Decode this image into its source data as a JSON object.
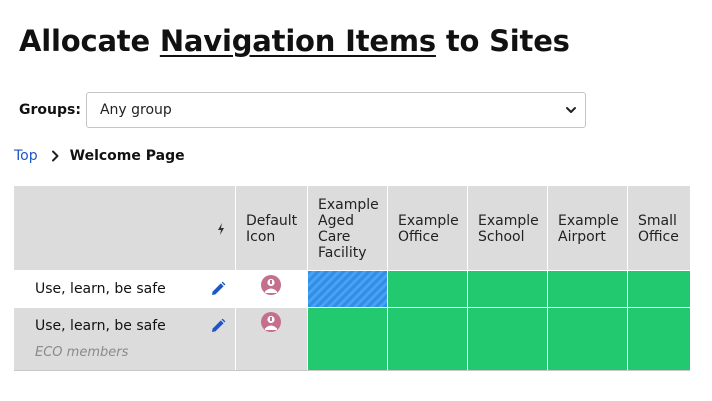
{
  "page": {
    "title_prefix": "Allocate ",
    "title_link": "Navigation Items",
    "title_suffix": " to Sites"
  },
  "groups": {
    "label": "Groups:",
    "selected": "Any group"
  },
  "breadcrumb": {
    "top": "Top",
    "current": "Welcome Page"
  },
  "table": {
    "columns": {
      "default_icon": [
        "Default",
        "Icon"
      ],
      "sites": [
        [
          "Example",
          "Aged",
          "Care",
          "Facility"
        ],
        [
          "Example",
          "Office"
        ],
        [
          "Example",
          "School"
        ],
        [
          "Example",
          "Airport"
        ],
        [
          "Small",
          "Office"
        ]
      ]
    },
    "rows": [
      {
        "label": "Use, learn, be safe",
        "sub": "",
        "cells": [
          "partial",
          "allocated",
          "allocated",
          "allocated",
          "allocated"
        ]
      },
      {
        "label": "Use, learn, be safe",
        "sub": "ECO members",
        "cells": [
          "allocated",
          "allocated",
          "allocated",
          "allocated",
          "allocated"
        ]
      }
    ]
  },
  "colors": {
    "allocated": "#22c96e",
    "partial": "#2f8fe8",
    "header_bg": "#dcdcdc",
    "link": "#1f56c6",
    "icon_pink": "#c46f8c"
  },
  "icons": {
    "sort": "lightning-bolt-icon",
    "edit": "pencil-icon",
    "default": "person-badge-icon",
    "select": "chevron-down-icon",
    "breadcrumb_sep": "chevron-right-icon"
  }
}
